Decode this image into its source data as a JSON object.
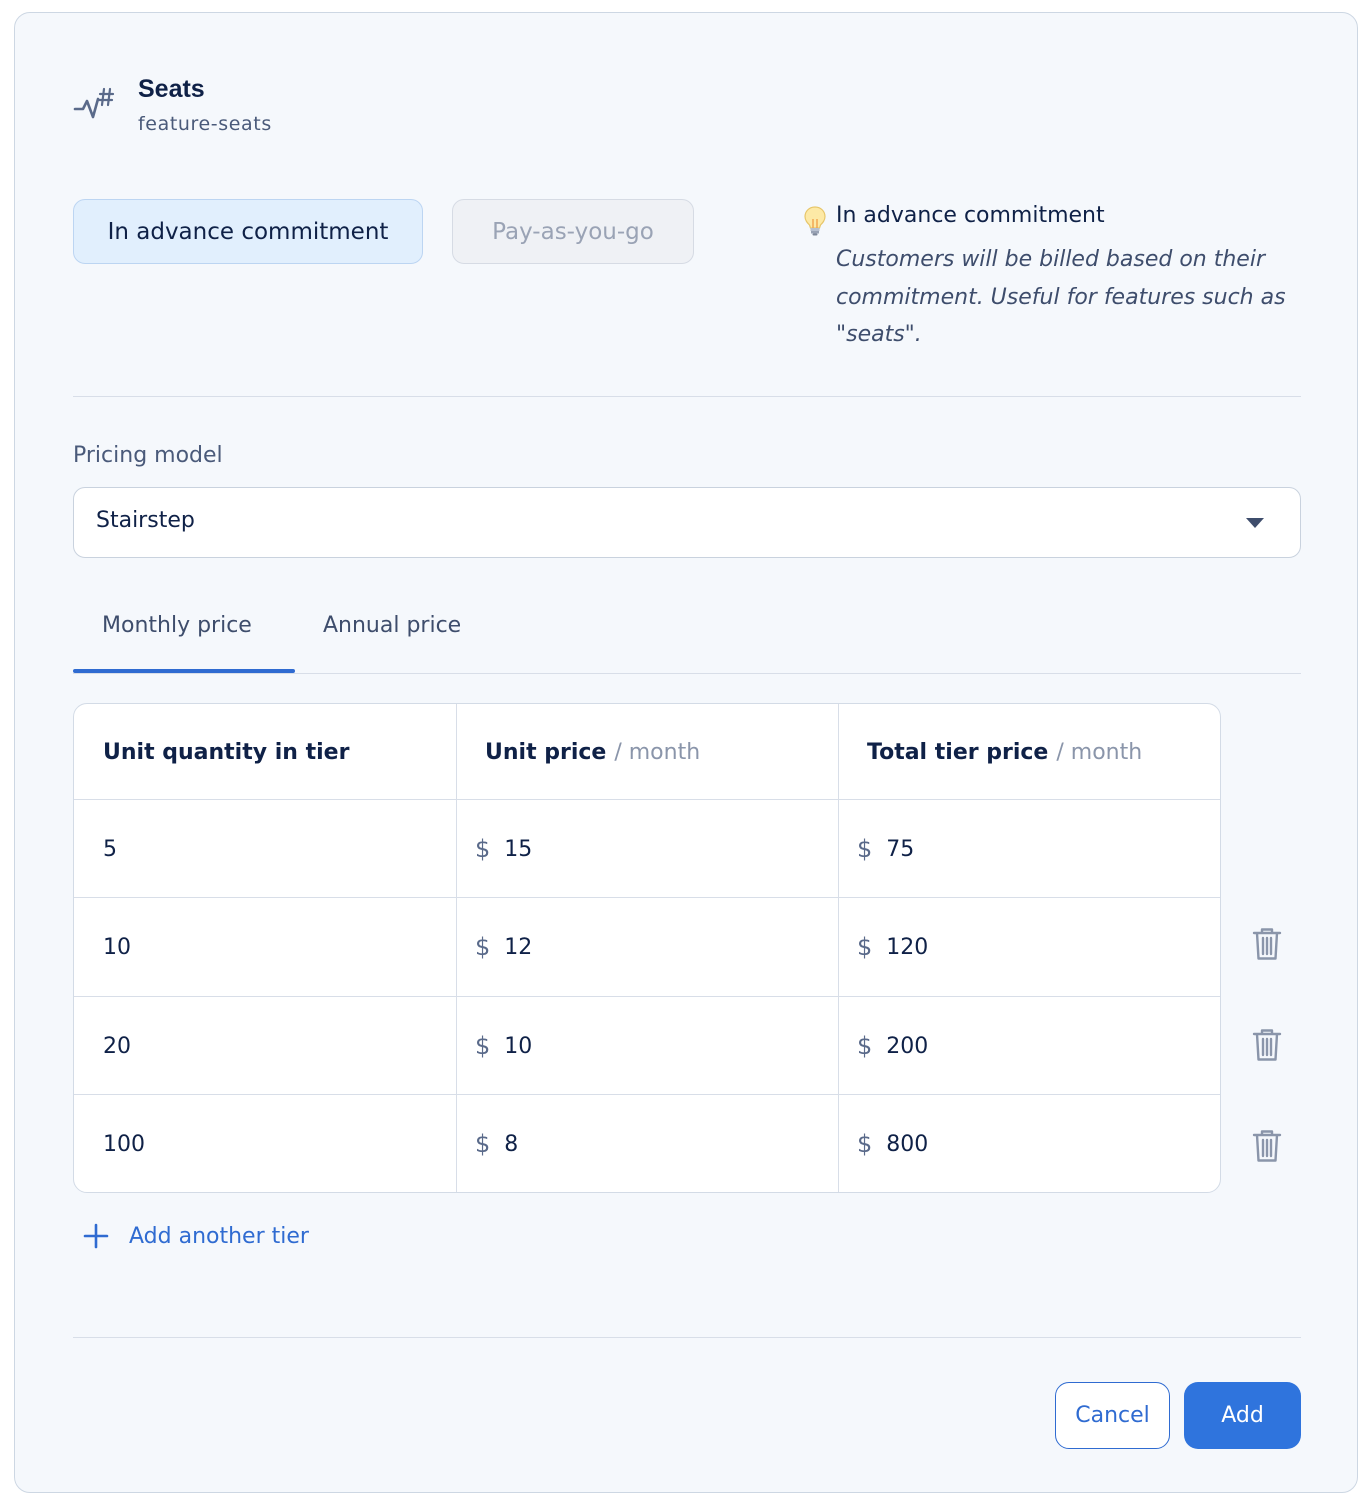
{
  "feature": {
    "icon": "activity-hash-icon",
    "title": "Seats",
    "key": "feature-seats"
  },
  "charge_modes": {
    "active": "In advance commitment",
    "inactive": "Pay-as-you-go"
  },
  "hint": {
    "icon": "lightbulb-icon",
    "title": "In advance commitment",
    "body": "Customers will be billed based on their commitment. Useful for features such as \"seats\"."
  },
  "pricing_model": {
    "label": "Pricing model",
    "value": "Stairstep"
  },
  "tabs": [
    {
      "label": "Monthly price",
      "selected": true
    },
    {
      "label": "Annual price",
      "selected": false
    }
  ],
  "table": {
    "headers": {
      "quantity": "Unit quantity in tier",
      "unit_price": "Unit price",
      "unit_price_per": "/ month",
      "total_price": "Total tier price",
      "total_price_per": "/ month"
    },
    "currency_symbol": "$",
    "rows": [
      {
        "quantity": "5",
        "unit_price": "15",
        "total": "75",
        "deletable": false
      },
      {
        "quantity": "10",
        "unit_price": "12",
        "total": "120",
        "deletable": true
      },
      {
        "quantity": "20",
        "unit_price": "10",
        "total": "200",
        "deletable": true
      },
      {
        "quantity": "100",
        "unit_price": "8",
        "total": "800",
        "deletable": true
      }
    ]
  },
  "add_tier_label": "Add another tier",
  "actions": {
    "cancel": "Cancel",
    "add": "Add"
  },
  "colors": {
    "accent": "#2f6bd1",
    "primary_button": "#2f74dd",
    "active_mode_bg": "#e1effd"
  }
}
